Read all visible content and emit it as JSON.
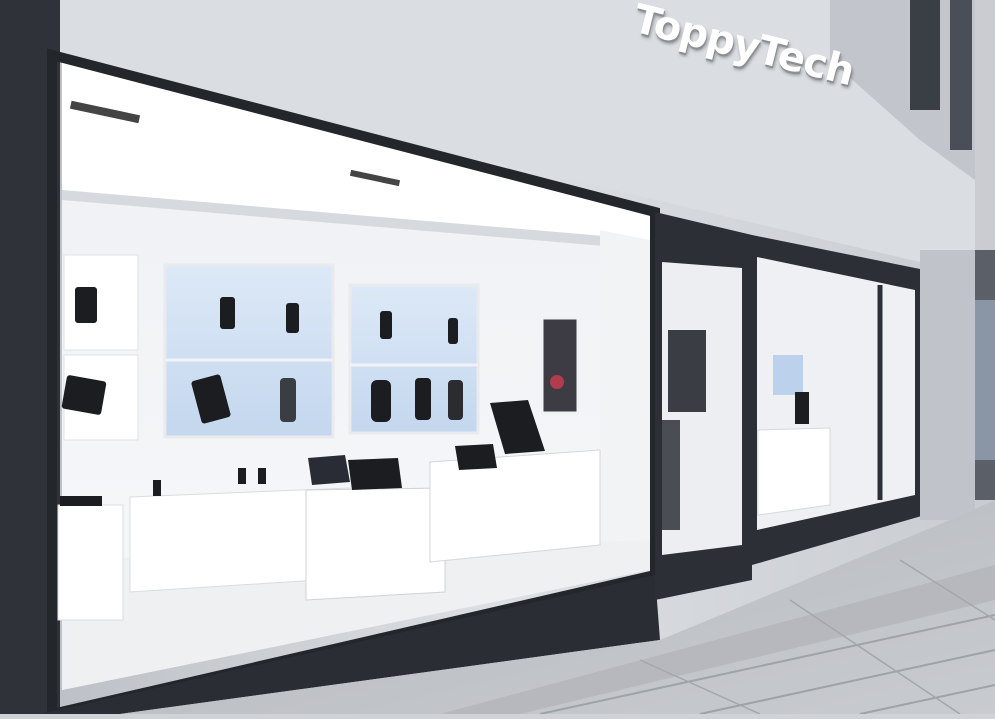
{
  "storefront": {
    "brand_sign": "ToppyTech"
  },
  "colors": {
    "facade": "#d9dce0",
    "frame": "#2a2d33",
    "interior": "#f4f5f7",
    "screen": "#cfe0f3",
    "pavement": "#b9bcc1"
  }
}
